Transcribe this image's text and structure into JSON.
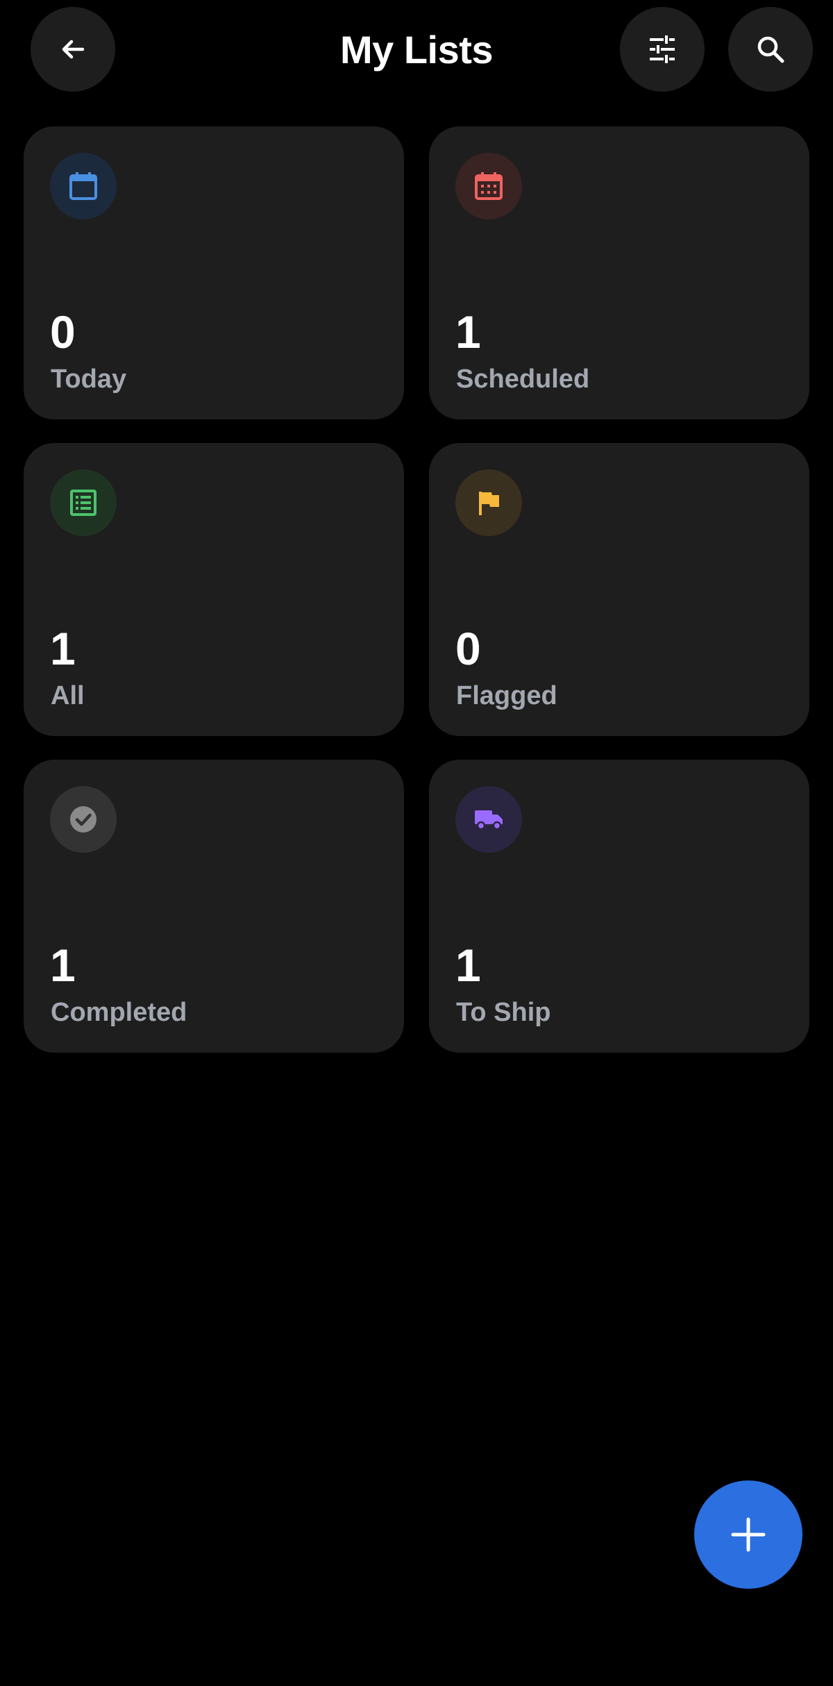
{
  "header": {
    "title": "My Lists",
    "back_icon": "arrow-left-icon",
    "filter_icon": "sliders-icon",
    "search_icon": "search-icon"
  },
  "lists": [
    {
      "id": "today",
      "count": "0",
      "label": "Today",
      "icon": "calendar-icon",
      "icon_color": "#4a90e2",
      "icon_bg": "#1c2a3d"
    },
    {
      "id": "scheduled",
      "count": "1",
      "label": "Scheduled",
      "icon": "calendar-grid-icon",
      "icon_color": "#ef6461",
      "icon_bg": "#3a2323"
    },
    {
      "id": "all",
      "count": "1",
      "label": "All",
      "icon": "list-icon",
      "icon_color": "#4cc36a",
      "icon_bg": "#1f3323"
    },
    {
      "id": "flagged",
      "count": "0",
      "label": "Flagged",
      "icon": "flag-icon",
      "icon_color": "#f6b93b",
      "icon_bg": "#3a3020"
    },
    {
      "id": "completed",
      "count": "1",
      "label": "Completed",
      "icon": "check-circle-icon",
      "icon_color": "#8a8a8a",
      "icon_bg": "#333333"
    },
    {
      "id": "to-ship",
      "count": "1",
      "label": "To Ship",
      "icon": "truck-icon",
      "icon_color": "#9a6bff",
      "icon_bg": "#2a2540"
    }
  ],
  "fab": {
    "icon": "plus-icon",
    "color": "#2b6fe0"
  }
}
